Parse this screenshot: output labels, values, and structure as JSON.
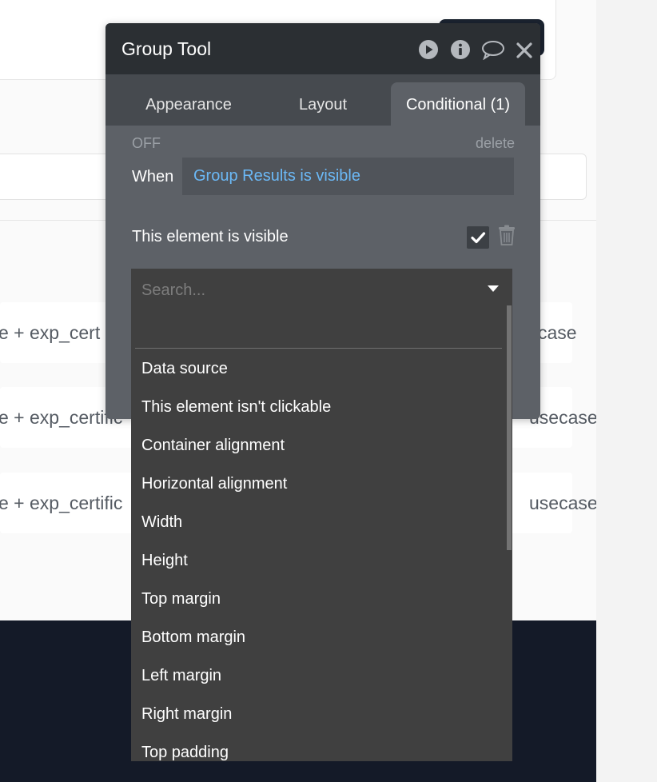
{
  "background": {
    "rows": [
      {
        "left": "e + exp_cert",
        "right": "case"
      },
      {
        "left": "e + exp_certific",
        "right": "usecase"
      },
      {
        "left": "e + exp_certific",
        "right": "usecase"
      }
    ]
  },
  "panel": {
    "title": "Group Tool",
    "header_icons": [
      "play-icon",
      "info-icon",
      "comment-icon",
      "close-icon"
    ],
    "tabs": [
      {
        "label": "Appearance",
        "active": false
      },
      {
        "label": "Layout",
        "active": false
      },
      {
        "label": "Conditional (1)",
        "active": true
      }
    ],
    "condition": {
      "status": "OFF",
      "delete_label": "delete",
      "when_label": "When",
      "when_expression": "Group Results is visible",
      "property_label": "This element is visible",
      "property_checked": true
    }
  },
  "dropdown": {
    "search_placeholder": "Search...",
    "options": [
      "Data source",
      "This element isn't clickable",
      "Container alignment",
      "Horizontal alignment",
      "Width",
      "Height",
      "Top margin",
      "Bottom margin",
      "Left margin",
      "Right margin",
      "Top padding"
    ]
  },
  "colors": {
    "header_bg": "#2b2f33",
    "panel_bg": "#5d6167",
    "expression_text": "#6bb8f5",
    "dropdown_bg": "#404040",
    "footer_bg": "#141a28"
  }
}
